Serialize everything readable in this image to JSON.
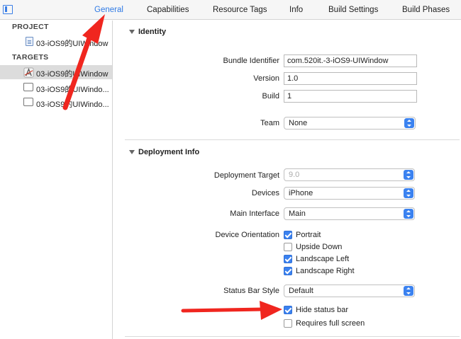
{
  "tabs": [
    {
      "label": "General",
      "active": true
    },
    {
      "label": "Capabilities"
    },
    {
      "label": "Resource Tags"
    },
    {
      "label": "Info"
    },
    {
      "label": "Build Settings"
    },
    {
      "label": "Build Phases"
    }
  ],
  "sidebar": {
    "project_header": "PROJECT",
    "targets_header": "TARGETS",
    "items": [
      {
        "label": "03-iOS9的UIWindow",
        "icon": "project-file-icon"
      },
      {
        "label": "03-iOS9的UIWindow",
        "icon": "app-target-icon",
        "selected": true
      },
      {
        "label": "03-iOS9的UIWindo...",
        "icon": "folder-icon"
      },
      {
        "label": "03-iOS9的UIWindo...",
        "icon": "folder-icon"
      }
    ]
  },
  "identity": {
    "title": "Identity",
    "bundle_identifier_label": "Bundle Identifier",
    "bundle_identifier_value": "com.520it.-3-iOS9-UIWindow",
    "version_label": "Version",
    "version_value": "1.0",
    "build_label": "Build",
    "build_value": "1",
    "team_label": "Team",
    "team_value": "None"
  },
  "deployment": {
    "title": "Deployment Info",
    "target_label": "Deployment Target",
    "target_value": "9.0",
    "devices_label": "Devices",
    "devices_value": "iPhone",
    "main_interface_label": "Main Interface",
    "main_interface_value": "Main",
    "orientation_label": "Device Orientation",
    "orientations": [
      {
        "label": "Portrait",
        "checked": true
      },
      {
        "label": "Upside Down",
        "checked": false
      },
      {
        "label": "Landscape Left",
        "checked": true
      },
      {
        "label": "Landscape Right",
        "checked": true
      }
    ],
    "status_bar_style_label": "Status Bar Style",
    "status_bar_style_value": "Default",
    "hide_status_bar_label": "Hide status bar",
    "hide_status_bar_checked": true,
    "requires_full_screen_label": "Requires full screen",
    "requires_full_screen_checked": false
  },
  "colors": {
    "accent": "#3b82f0",
    "annotation_arrow": "#f0261f"
  }
}
